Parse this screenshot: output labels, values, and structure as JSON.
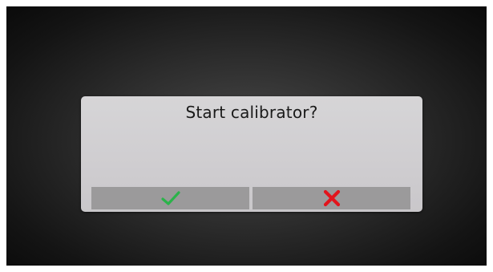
{
  "dialog": {
    "title": "Start calibrator?",
    "confirm_icon": "checkmark-icon",
    "cancel_icon": "x-icon"
  },
  "colors": {
    "confirm": "#2bb34a",
    "cancel": "#e2141c",
    "button_bg": "#9b9a9b",
    "dialog_bg": "#d1d0d2"
  }
}
